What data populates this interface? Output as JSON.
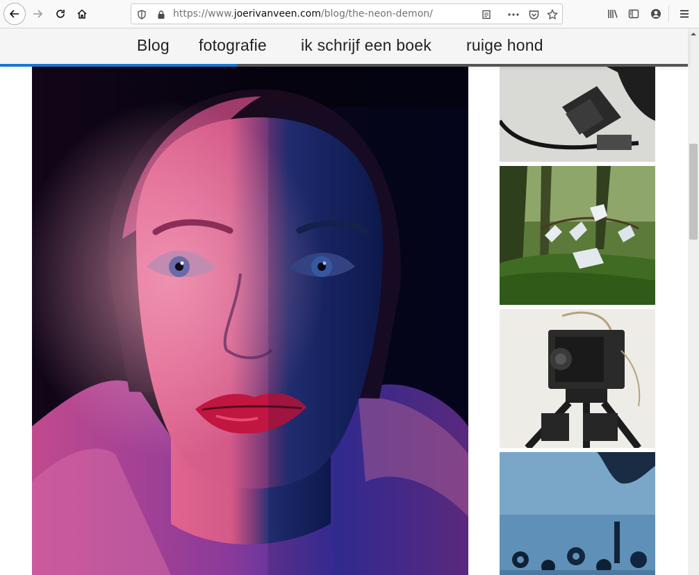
{
  "browser": {
    "url_prefix": "https://www.",
    "url_domain": "joerivanveen.com",
    "url_path": "/blog/the-neon-demon/",
    "icons": [
      "back-icon",
      "forward-icon",
      "reload-icon",
      "home-icon",
      "shield-icon",
      "lock-icon",
      "reader-view-icon",
      "more-icon",
      "pocket-icon",
      "bookmark-star-icon",
      "library-icon",
      "sidebar-icon",
      "account-icon",
      "menu-icon"
    ]
  },
  "nav": {
    "items": [
      "Blog",
      "fotografie",
      "ik schrijf een boek",
      "ruige hond"
    ]
  },
  "reading_progress": 0.344,
  "colors": {
    "accent": "#1976d2",
    "magenta": "#d0306e",
    "blue": "#1c2a8a"
  },
  "images": {
    "hero": "Portrait in neon magenta and blue light",
    "thumbs": [
      "Camera with cable",
      "Gloves on branches in forest",
      "Large format camera on tripod",
      "Screws and bolts on blue surface"
    ]
  }
}
